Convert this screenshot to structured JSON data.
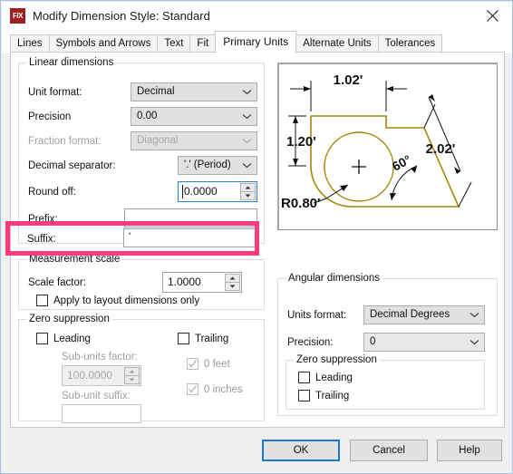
{
  "window": {
    "title": "Modify Dimension Style: Standard",
    "icon": "fx-logo-icon",
    "icon_text": "F/X",
    "close_icon": "close-icon",
    "accent_highlight": "#fa3c78",
    "default_button_border": "#1878d2",
    "drawing_color": "#a8860b"
  },
  "tabs": [
    {
      "label": "Lines",
      "active": false
    },
    {
      "label": "Symbols and Arrows",
      "active": false
    },
    {
      "label": "Text",
      "active": false
    },
    {
      "label": "Fit",
      "active": false
    },
    {
      "label": "Primary Units",
      "active": true
    },
    {
      "label": "Alternate Units",
      "active": false
    },
    {
      "label": "Tolerances",
      "active": false
    }
  ],
  "linear_dimensions": {
    "legend": "Linear dimensions",
    "unit_format": {
      "label": "Unit format:",
      "value": "Decimal"
    },
    "precision": {
      "label": "Precision",
      "value": "0.00"
    },
    "fraction_format": {
      "label": "Fraction format:",
      "value": "Diagonal",
      "disabled": true
    },
    "decimal_separator": {
      "label": "Decimal separator:",
      "value": "'.' (Period)"
    },
    "round_off": {
      "label": "Round off:",
      "value": "0.0000",
      "focused": true
    },
    "prefix": {
      "label": "Prefix:",
      "value": ""
    },
    "suffix": {
      "label": "Suffix:",
      "value": "'",
      "highlighted": true
    }
  },
  "measurement_scale": {
    "legend": "Measurement scale",
    "scale_factor": {
      "label": "Scale factor:",
      "value": "1.0000"
    },
    "apply_layout": {
      "label": "Apply to layout dimensions only",
      "checked": false
    }
  },
  "zero_suppression_linear": {
    "legend": "Zero suppression",
    "leading": {
      "label": "Leading",
      "checked": false
    },
    "trailing": {
      "label": "Trailing",
      "checked": false
    },
    "sub_units_factor": {
      "label": "Sub-units factor:",
      "value": "100.0000",
      "disabled": true
    },
    "sub_unit_suffix": {
      "label": "Sub-unit suffix:",
      "value": "",
      "disabled": true
    },
    "zero_feet": {
      "label": "0 feet",
      "checked": true,
      "disabled": true
    },
    "zero_inches": {
      "label": "0 inches",
      "checked": true,
      "disabled": true
    }
  },
  "angular_dimensions": {
    "legend": "Angular dimensions",
    "units_format": {
      "label": "Units format:",
      "value": "Decimal Degrees"
    },
    "precision": {
      "label": "Precision:",
      "value": "0"
    },
    "zero_suppression": {
      "legend": "Zero suppression",
      "leading": {
        "label": "Leading",
        "checked": false
      },
      "trailing": {
        "label": "Trailing",
        "checked": false
      }
    }
  },
  "preview": {
    "name": "dimension-style-preview",
    "labels": {
      "top_width": "1.02'",
      "left_height": "1.20'",
      "slant_length": "2.02'",
      "angle": "60°",
      "radius": "R0.80'"
    }
  },
  "footer": {
    "ok": "OK",
    "cancel": "Cancel",
    "help": "Help"
  }
}
